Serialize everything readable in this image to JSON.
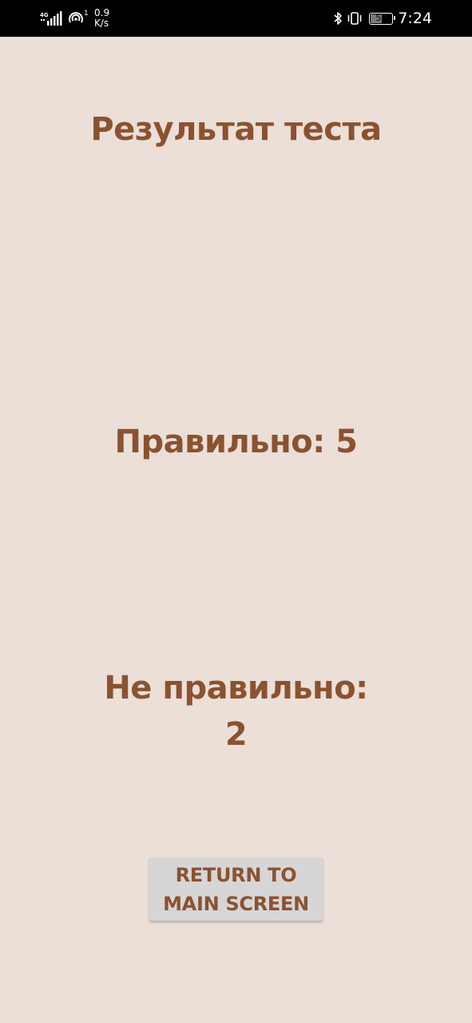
{
  "status_bar": {
    "network_type": "4G",
    "hotspot_count": "1",
    "speed_value": "0.9",
    "speed_unit": "K/s",
    "battery_level": "52",
    "time": "7:24",
    "icons": [
      "signal-icon",
      "hotspot-icon",
      "bluetooth-icon",
      "vibrate-icon",
      "battery-icon"
    ]
  },
  "screen": {
    "title": "Результат теста",
    "correct_text": "Правильно: 5",
    "incorrect_text": "Не правильно: 2",
    "text_color": "#8b5230",
    "background_color": "#ecdfd8"
  },
  "actions": {
    "return_label": "RETURN TO MAIN SCREEN",
    "button_color": "#d6d6d6"
  }
}
